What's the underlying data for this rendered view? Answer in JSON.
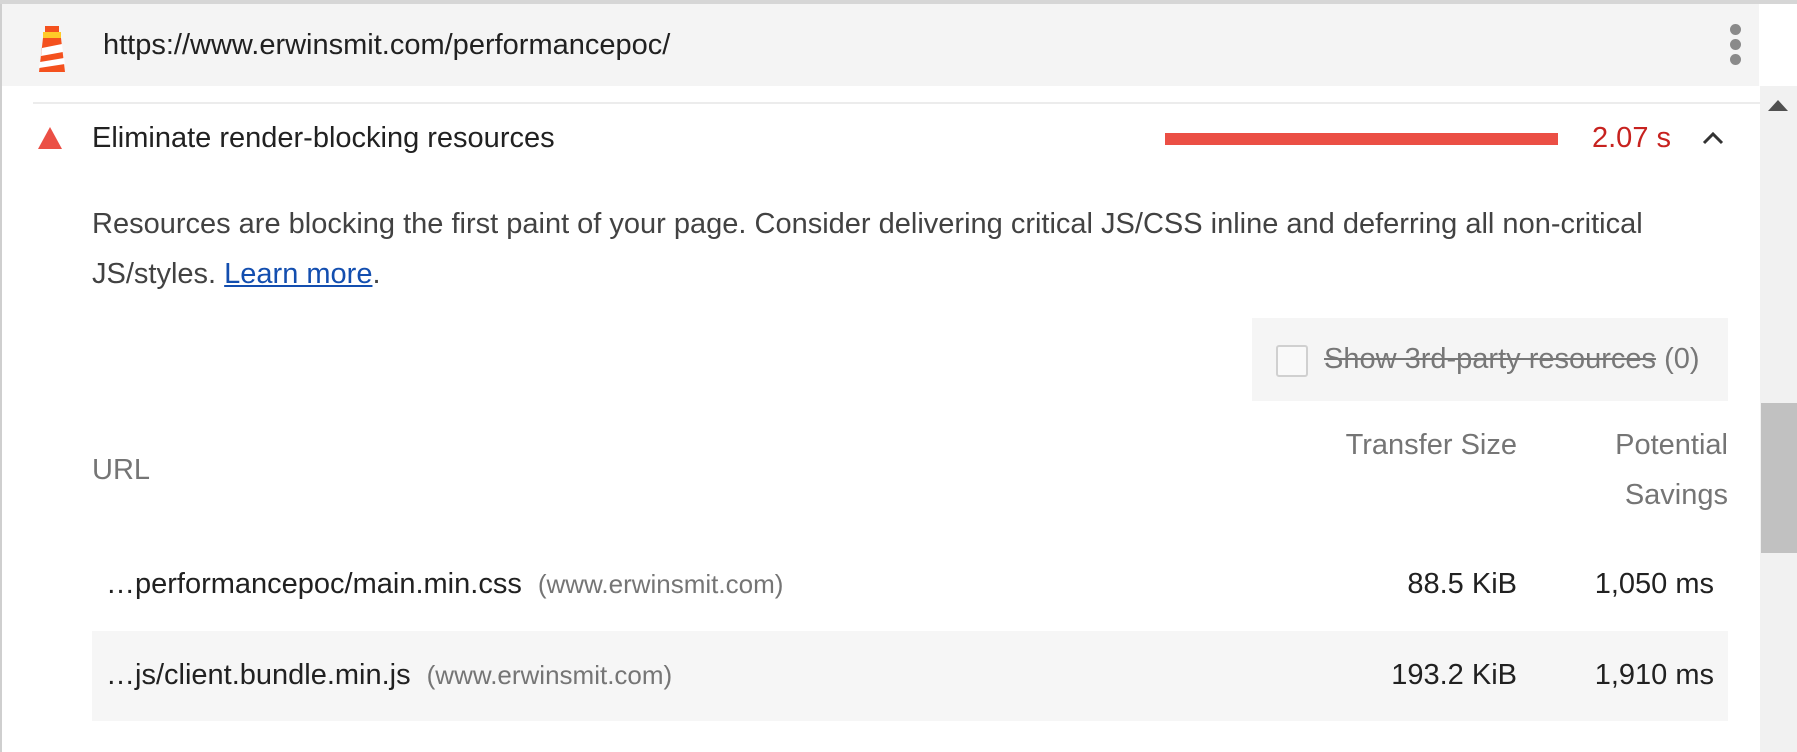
{
  "topbar": {
    "logo_icon": "lighthouse-icon",
    "url": "https://www.erwinsmit.com/performancepoc/",
    "menu_icon": "kebab-menu-icon"
  },
  "audit": {
    "status_icon": "fail-triangle-icon",
    "title": "Eliminate render-blocking resources",
    "display_value": "2.07 s",
    "expanded": true,
    "toggle_icon": "chevron-up-icon",
    "status_color": "#eb4f45",
    "description_text": "Resources are blocking the first paint of your page. Consider delivering critical JS/CSS inline and deferring all non-critical JS/styles. ",
    "learn_more_label": "Learn more",
    "description_end": "."
  },
  "third_party_filter": {
    "label": "Show 3rd-party resources",
    "count": "(0)",
    "checked": false
  },
  "table": {
    "headers": {
      "url": "URL",
      "transfer_size": "Transfer Size",
      "potential_savings": "Potential Savings"
    },
    "rows": [
      {
        "url": "…performancepoc/main.min.css",
        "host": "(www.erwinsmit.com)",
        "transfer_size": "88.5 KiB",
        "savings": "1,050 ms"
      },
      {
        "url": "…js/client.bundle.min.js",
        "host": "(www.erwinsmit.com)",
        "transfer_size": "193.2 KiB",
        "savings": "1,910 ms"
      }
    ]
  },
  "scrollbar": {
    "up_icon": "scroll-up-arrow-icon"
  }
}
